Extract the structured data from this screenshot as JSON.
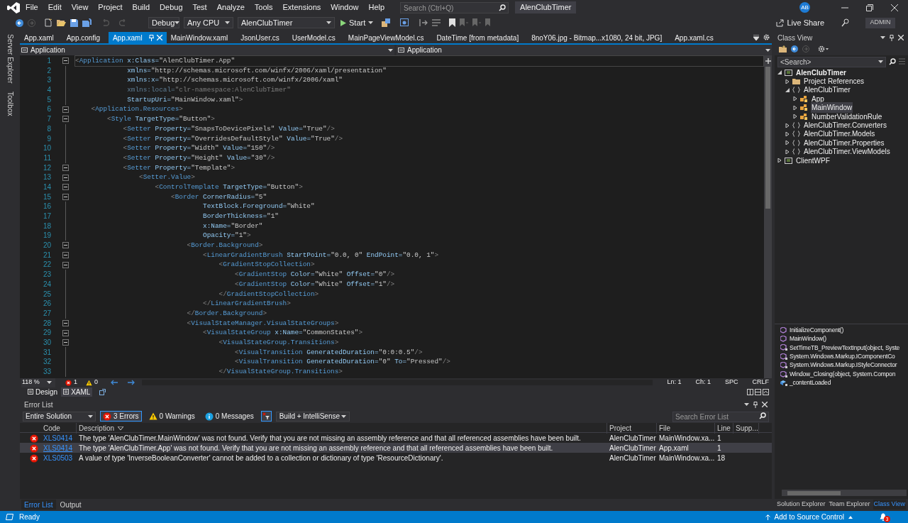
{
  "window": {
    "title": "AlenClubTimer",
    "search_placeholder": "Search (Ctrl+Q)",
    "avatar": "AB",
    "menu": [
      "File",
      "Edit",
      "View",
      "Project",
      "Build",
      "Debug",
      "Test",
      "Analyze",
      "Tools",
      "Extensions",
      "Window",
      "Help"
    ]
  },
  "toolbar": {
    "configuration": "Debug",
    "platform": "Any CPU",
    "startup_project": "AlenClubTimer",
    "start": "Start",
    "live_share": "Live Share",
    "admin": "ADMIN"
  },
  "side_tabs": [
    "Server Explorer",
    "Toolbox"
  ],
  "tabs": [
    {
      "label": "App.xaml",
      "selected": false
    },
    {
      "label": "App.config",
      "selected": false
    },
    {
      "label": "App.xaml",
      "selected": true
    },
    {
      "label": "MainWindow.xaml",
      "selected": false
    },
    {
      "label": "JsonUser.cs",
      "selected": false
    },
    {
      "label": "UserModel.cs",
      "selected": false
    },
    {
      "label": "MainPageViewModel.cs",
      "selected": false
    },
    {
      "label": "DateTime [from metadata]",
      "selected": false
    },
    {
      "label": "8noY06.jpg - Bitmap...x1080, 24 bit, JPG]",
      "selected": false
    },
    {
      "label": "App.xaml.cs",
      "selected": false
    }
  ],
  "nav_bar": {
    "left": "Application",
    "right": "Application"
  },
  "code_lines": [
    {
      "number": "1",
      "code": "<Application x:Class=\"AlenClubTimer.App\"",
      "foldable": true,
      "dimmed": false,
      "current": true
    },
    {
      "number": "2",
      "code": "             xmlns=\"http://schemas.microsoft.com/winfx/2006/xaml/presentation\"",
      "foldable": false,
      "dimmed": false,
      "current": false
    },
    {
      "number": "3",
      "code": "             xmlns:x=\"http://schemas.microsoft.com/winfx/2006/xaml\"",
      "foldable": false,
      "dimmed": false,
      "current": false
    },
    {
      "number": "4",
      "code": "             xmlns:local=\"clr-namespace:AlenClubTimer\"",
      "foldable": false,
      "dimmed": true,
      "current": false
    },
    {
      "number": "5",
      "code": "             StartupUri=\"MainWindow.xaml\">",
      "foldable": false,
      "dimmed": false,
      "current": false
    },
    {
      "number": "6",
      "code": "    <Application.Resources>",
      "foldable": true,
      "dimmed": false,
      "current": false
    },
    {
      "number": "7",
      "code": "        <Style TargetType=\"Button\">",
      "foldable": true,
      "dimmed": false,
      "current": false
    },
    {
      "number": "8",
      "code": "            <Setter Property=\"SnapsToDevicePixels\" Value=\"True\"/>",
      "foldable": false,
      "dimmed": false,
      "current": false
    },
    {
      "number": "9",
      "code": "            <Setter Property=\"OverridesDefaultStyle\" Value=\"True\"/>",
      "foldable": false,
      "dimmed": false,
      "current": false
    },
    {
      "number": "10",
      "code": "            <Setter Property=\"Width\" Value=\"150\"/>",
      "foldable": false,
      "dimmed": false,
      "current": false
    },
    {
      "number": "11",
      "code": "            <Setter Property=\"Height\" Value=\"30\"/>",
      "foldable": false,
      "dimmed": false,
      "current": false
    },
    {
      "number": "12",
      "code": "            <Setter Property=\"Template\">",
      "foldable": true,
      "dimmed": false,
      "current": false
    },
    {
      "number": "13",
      "code": "                <Setter.Value>",
      "foldable": true,
      "dimmed": false,
      "current": false
    },
    {
      "number": "14",
      "code": "                    <ControlTemplate TargetType=\"Button\">",
      "foldable": true,
      "dimmed": false,
      "current": false
    },
    {
      "number": "15",
      "code": "                        <Border CornerRadius=\"5\"",
      "foldable": true,
      "dimmed": false,
      "current": false
    },
    {
      "number": "16",
      "code": "                                TextBlock.Foreground=\"White\"",
      "foldable": false,
      "dimmed": false,
      "current": false
    },
    {
      "number": "17",
      "code": "                                BorderThickness=\"1\"",
      "foldable": false,
      "dimmed": false,
      "current": false
    },
    {
      "number": "18",
      "code": "                                x:Name=\"Border\"",
      "foldable": false,
      "dimmed": false,
      "current": false
    },
    {
      "number": "19",
      "code": "                                Opacity=\"1\">",
      "foldable": false,
      "dimmed": false,
      "current": false
    },
    {
      "number": "20",
      "code": "                            <Border.Background>",
      "foldable": true,
      "dimmed": false,
      "current": false
    },
    {
      "number": "21",
      "code": "                                <LinearGradientBrush StartPoint=\"0.0, 0\" EndPoint=\"0.0, 1\">",
      "foldable": true,
      "dimmed": false,
      "current": false
    },
    {
      "number": "22",
      "code": "                                    <GradientStopCollection>",
      "foldable": true,
      "dimmed": false,
      "current": false
    },
    {
      "number": "23",
      "code": "                                        <GradientStop Color=\"White\" Offset=\"0\"/>",
      "foldable": false,
      "dimmed": false,
      "current": false
    },
    {
      "number": "24",
      "code": "                                        <GradientStop Color=\"White\" Offset=\"1\"/>",
      "foldable": false,
      "dimmed": false,
      "current": false
    },
    {
      "number": "25",
      "code": "                                    </GradientStopCollection>",
      "foldable": false,
      "dimmed": false,
      "current": false
    },
    {
      "number": "26",
      "code": "                                </LinearGradientBrush>",
      "foldable": false,
      "dimmed": false,
      "current": false
    },
    {
      "number": "27",
      "code": "                            </Border.Background>",
      "foldable": false,
      "dimmed": false,
      "current": false
    },
    {
      "number": "28",
      "code": "                            <VisualStateManager.VisualStateGroups>",
      "foldable": true,
      "dimmed": false,
      "current": false
    },
    {
      "number": "29",
      "code": "                                <VisualStateGroup x:Name=\"CommonStates\">",
      "foldable": true,
      "dimmed": false,
      "current": false
    },
    {
      "number": "30",
      "code": "                                    <VisualStateGroup.Transitions>",
      "foldable": true,
      "dimmed": false,
      "current": false
    },
    {
      "number": "31",
      "code": "                                        <VisualTransition GeneratedDuration=\"0:0:0.5\"/>",
      "foldable": false,
      "dimmed": false,
      "current": false
    },
    {
      "number": "32",
      "code": "                                        <VisualTransition GeneratedDuration=\"0\" To=\"Pressed\"/>",
      "foldable": false,
      "dimmed": false,
      "current": false
    },
    {
      "number": "33",
      "code": "                                    </VisualStateGroup.Transitions>",
      "foldable": false,
      "dimmed": false,
      "current": false
    }
  ],
  "editor_status": {
    "zoom": "118 %",
    "errors": "1",
    "warnings": "0",
    "line": "Ln: 1",
    "column": "Ch: 1",
    "spacing": "SPC",
    "line_ending": "CRLF"
  },
  "design_tabs": [
    {
      "label": "Design",
      "selected": false
    },
    {
      "label": "XAML",
      "selected": true
    }
  ],
  "error_list": {
    "title": "Error List",
    "scope": "Entire Solution",
    "filters": [
      {
        "kind": "error",
        "label": "3 Errors",
        "on": true
      },
      {
        "kind": "warning",
        "label": "0 Warnings",
        "on": false
      },
      {
        "kind": "message",
        "label": "0 Messages",
        "on": false
      }
    ],
    "source": "Build + IntelliSense",
    "search_placeholder": "Search Error List",
    "columns": [
      "Code",
      "Description",
      "Project",
      "File",
      "Line",
      "Supp..."
    ],
    "rows": [
      {
        "code": "XLS0414",
        "description": "The type 'AlenClubTimer.MainWindow' was not found. Verify that you are not missing an assembly reference and that all referenced assemblies have been built.",
        "project": "AlenClubTimer",
        "file": "MainWindow.xa...",
        "line": "1",
        "selected": false
      },
      {
        "code": "XLS0414",
        "description": "The type 'AlenClubTimer.App' was not found. Verify that you are not missing an assembly reference and that all referenced assemblies have been built.",
        "project": "AlenClubTimer",
        "file": "App.xaml",
        "line": "1",
        "selected": true
      },
      {
        "code": "XLS0503",
        "description": "A value of type 'InverseBooleanConverter' cannot be added to a collection or dictionary of type 'ResourceDictionary'.",
        "project": "AlenClubTimer",
        "file": "MainWindow.xa...",
        "line": "18",
        "selected": false
      }
    ]
  },
  "bottom_tabs": [
    {
      "label": "Error List",
      "selected": true
    },
    {
      "label": "Output",
      "selected": false
    }
  ],
  "class_view": {
    "title": "Class View",
    "search_placeholder": "<Search>",
    "tree": [
      {
        "label": "AlenClubTimer",
        "kind": "project",
        "expanded": true,
        "selected": false,
        "children": [
          {
            "label": "Project References",
            "kind": "folder",
            "expanded": false,
            "selected": false
          },
          {
            "label": "AlenClubTimer",
            "kind": "namespace",
            "expanded": true,
            "selected": false,
            "children": [
              {
                "label": "App",
                "kind": "class",
                "expanded": false,
                "selected": false
              },
              {
                "label": "MainWindow",
                "kind": "class",
                "expanded": false,
                "selected": true
              },
              {
                "label": "NumberValidationRule",
                "kind": "class",
                "expanded": false,
                "selected": false
              }
            ]
          },
          {
            "label": "AlenClubTimer.Converters",
            "kind": "namespace",
            "expanded": false,
            "selected": false
          },
          {
            "label": "AlenClubTimer.Models",
            "kind": "namespace",
            "expanded": false,
            "selected": false
          },
          {
            "label": "AlenClubTimer.Properties",
            "kind": "namespace",
            "expanded": false,
            "selected": false
          },
          {
            "label": "AlenClubTimer.ViewModels",
            "kind": "namespace",
            "expanded": false,
            "selected": false
          }
        ]
      },
      {
        "label": "ClientWPF",
        "kind": "project",
        "expanded": false,
        "selected": false
      }
    ],
    "members": [
      {
        "label": "InitializeComponent()",
        "kind": "method"
      },
      {
        "label": "MainWindow()",
        "kind": "method"
      },
      {
        "label": "SetTimeTB_PreviewTextInput(object, Syste",
        "kind": "private-method"
      },
      {
        "label": "System.Windows.Markup.IComponentCo",
        "kind": "private-method"
      },
      {
        "label": "System.Windows.Markup.IStyleConnector",
        "kind": "private-method"
      },
      {
        "label": "Window_Closing(object, System.Compon",
        "kind": "private-method"
      },
      {
        "label": "_contentLoaded",
        "kind": "field"
      }
    ],
    "tabs": [
      {
        "label": "Solution Explorer",
        "selected": false
      },
      {
        "label": "Team Explorer",
        "selected": false
      },
      {
        "label": "Class View",
        "selected": true
      }
    ]
  },
  "status_bar": {
    "ready": "Ready",
    "source_control": "Add to Source Control",
    "notifications": "3"
  }
}
